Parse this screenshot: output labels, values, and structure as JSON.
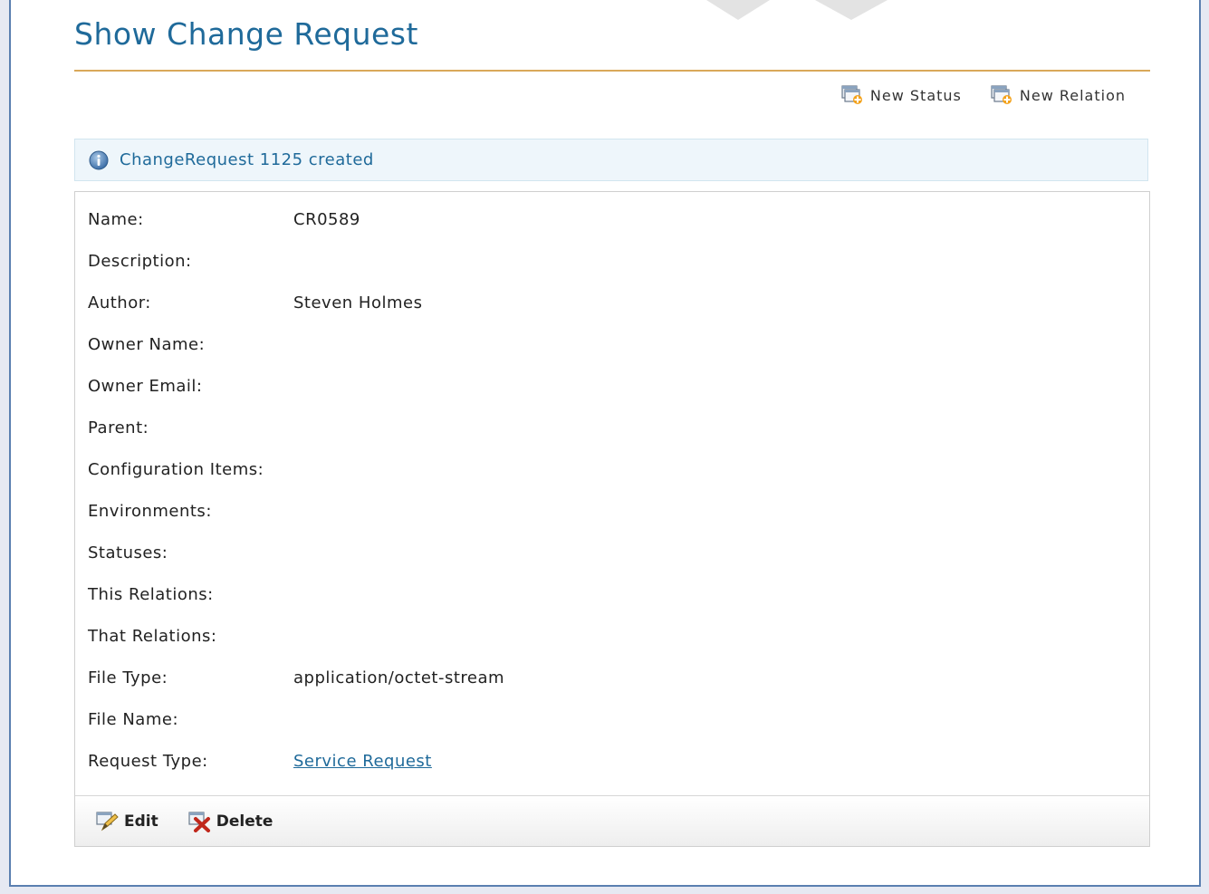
{
  "page": {
    "title": "Show Change Request"
  },
  "actions": {
    "new_status": "New Status",
    "new_relation": "New Relation"
  },
  "flash": {
    "message": "ChangeRequest 1125 created"
  },
  "fields": [
    {
      "label": "Name:",
      "value": "CR0589"
    },
    {
      "label": "Description:",
      "value": ""
    },
    {
      "label": "Author:",
      "value": "Steven Holmes"
    },
    {
      "label": "Owner Name:",
      "value": ""
    },
    {
      "label": "Owner Email:",
      "value": ""
    },
    {
      "label": "Parent:",
      "value": ""
    },
    {
      "label": "Configuration Items:",
      "value": ""
    },
    {
      "label": "Environments:",
      "value": ""
    },
    {
      "label": "Statuses:",
      "value": ""
    },
    {
      "label": "This Relations:",
      "value": ""
    },
    {
      "label": "That Relations:",
      "value": ""
    },
    {
      "label": "File Type:",
      "value": "application/octet-stream"
    },
    {
      "label": "File Name:",
      "value": ""
    },
    {
      "label": "Request Type:",
      "value": "Service Request"
    }
  ],
  "footer": {
    "edit": "Edit",
    "delete": "Delete"
  },
  "colors": {
    "accent": "#1f6a9a",
    "rule": "#d9a85a",
    "frame": "#5a7fb0"
  },
  "icons": {
    "new_status": "add-window-icon",
    "new_relation": "add-window-icon",
    "flash": "info-icon",
    "edit": "edit-pencil-icon",
    "delete": "delete-x-icon"
  }
}
